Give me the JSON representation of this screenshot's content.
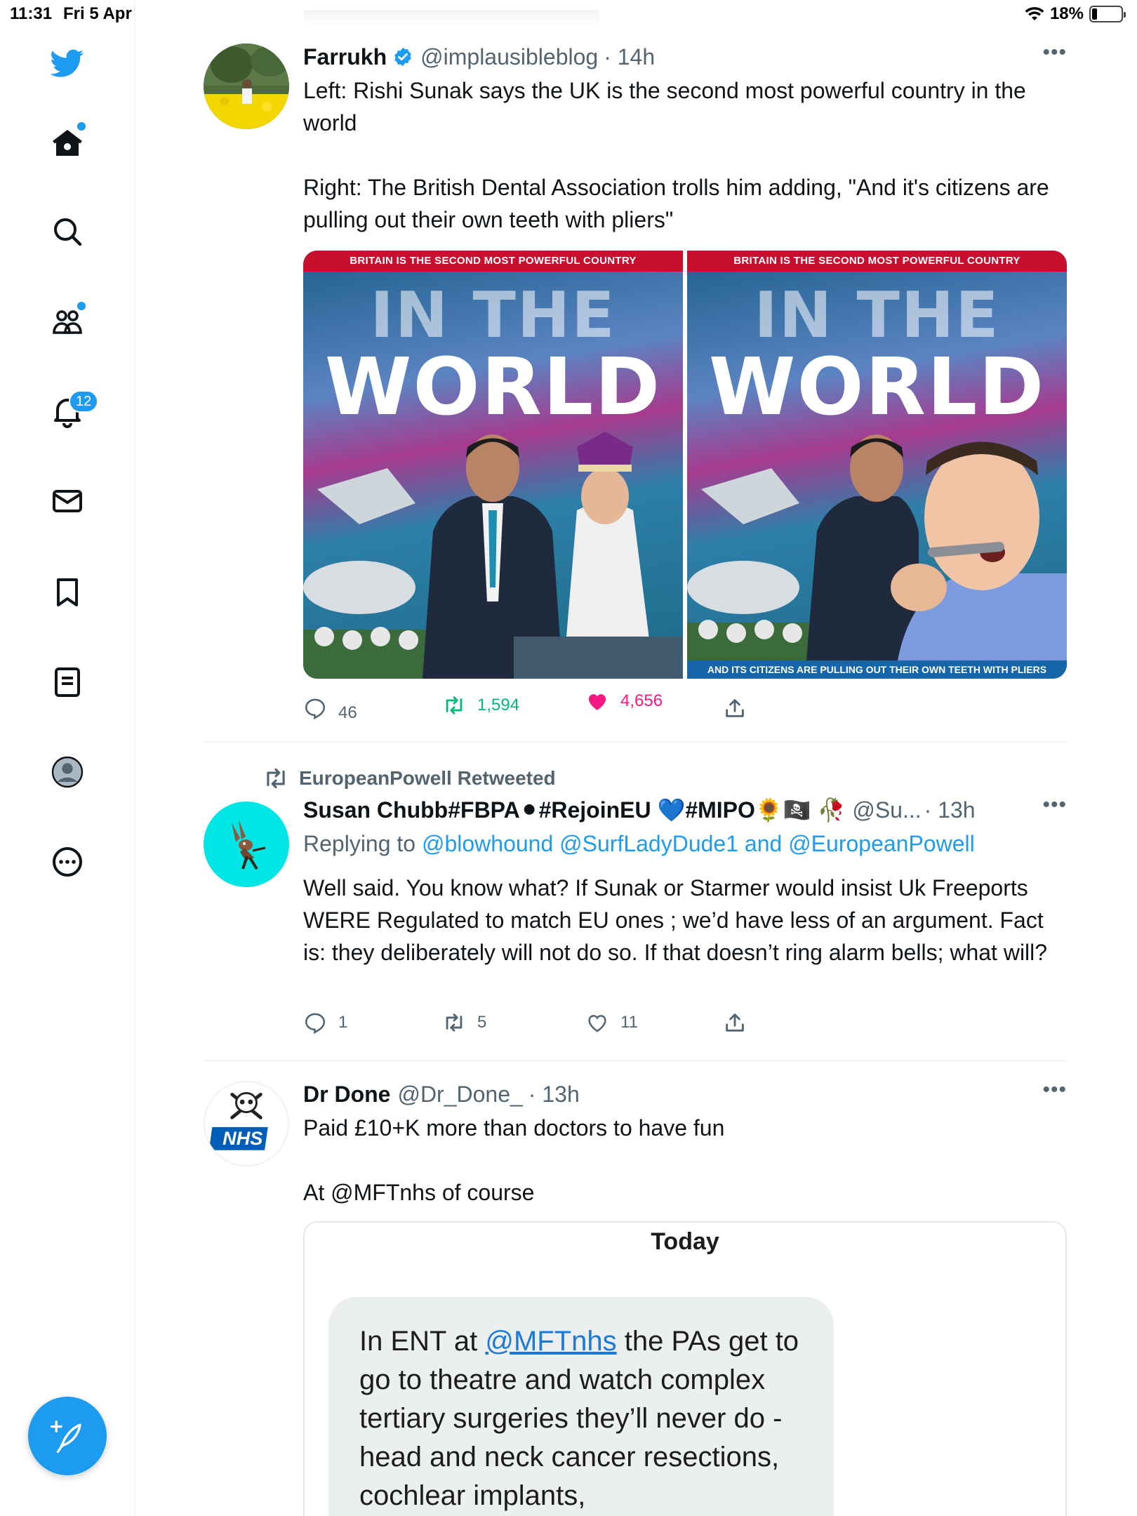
{
  "status_bar": {
    "time": "11:31",
    "date": "Fri 5 Apr",
    "battery": "18%",
    "battery_level": 0.18
  },
  "sidebar": {
    "notifications_badge": "12",
    "items": [
      "twitter-logo",
      "home",
      "explore",
      "communities",
      "notifications",
      "messages",
      "bookmarks",
      "lists",
      "profile",
      "more"
    ]
  },
  "tweets": [
    {
      "name": "Farrukh",
      "verified": true,
      "handle": "@implausibleblog",
      "time": "· 14h",
      "text": "Left: Rishi Sunak says the UK is the second most powerful country in the world\n\nRight: The British Dental Association trolls him adding, \"And it's citizens are pulling out their own teeth with pliers\"",
      "media": {
        "left": {
          "banner": "BRITAIN IS THE SECOND MOST POWERFUL COUNTRY",
          "line1": "IN THE",
          "line2": "WORLD"
        },
        "right": {
          "banner": "BRITAIN IS THE SECOND MOST POWERFUL COUNTRY",
          "line1": "IN THE",
          "line2": "WORLD",
          "footer": "AND ITS CITIZENS ARE PULLING OUT THEIR OWN TEETH WITH PLIERS"
        }
      },
      "replies": "46",
      "retweets": "1,594",
      "likes": "4,656",
      "retweet_color": "#00ba7c",
      "like_color": "#f91880"
    },
    {
      "context": "EuropeanPowell Retweeted",
      "name": "Susan Chubb#FBPA⚫#RejoinEU 💙#MIPO🌻🏴‍☠️ 🥀",
      "handle": "@Su...",
      "time": "· 13h",
      "replying_label": "Replying to",
      "replying_to": "@blowhound @SurfLadyDude1 and @EuropeanPowell",
      "text": "Well said. You know what? If Sunak or Starmer would insist Uk Freeports WERE Regulated to match EU ones ; we’d have less of an argument. Fact is: they deliberately will not do so. If that doesn’t ring alarm bells; what will?",
      "replies": "1",
      "retweets": "5",
      "likes": "11"
    },
    {
      "name": "Dr Done",
      "handle": "@Dr_Done_",
      "time": "· 13h",
      "avatar_text": "NHS",
      "text": "Paid £10+K more than doctors to have fun\n\nAt @MFTnhs of course",
      "embed": {
        "day": "Today",
        "bubble_pre": "In ENT at ",
        "bubble_link": "@MFTnhs",
        "bubble_post": " the PAs get to go to theatre and watch complex tertiary surgeries they’ll never do - head and neck cancer resections, cochlear implants,"
      }
    }
  ],
  "colors": {
    "accent": "#1d9bf0",
    "secondary_text": "#536471",
    "divider": "#eff3f4"
  }
}
